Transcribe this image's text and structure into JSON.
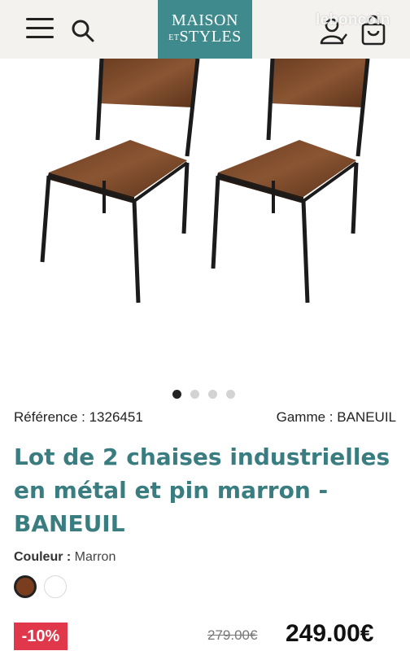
{
  "header": {
    "logo_line1": "MAISON",
    "logo_line2_prefix": "ET",
    "logo_line2": "STYLES",
    "watermark": "leboncoin"
  },
  "icons": {
    "menu": "hamburger-menu-icon",
    "search": "search-icon",
    "account": "user-account-icon",
    "cart": "shopping-bag-icon"
  },
  "gallery": {
    "total_slides": 4,
    "active_slide": 1
  },
  "product": {
    "reference_label": "Référence : 1326451",
    "range_label": "Gamme : BANEUIL",
    "title": "Lot de 2 chaises industrielles en métal et pin marron - BANEUIL",
    "color_label": "Couleur :",
    "color_value": "Marron",
    "swatches": [
      {
        "name": "Marron",
        "color": "#7a3e1e",
        "selected": true
      },
      {
        "name": "Blanc",
        "color": "#ffffff",
        "selected": false
      }
    ],
    "discount": "-10%",
    "old_price": "279.00€",
    "price": "249.00€"
  },
  "colors": {
    "brand": "#3f8a8c",
    "title": "#3a7d80",
    "discount_bg": "#e0374a",
    "header_bg": "#f3f2ef"
  }
}
